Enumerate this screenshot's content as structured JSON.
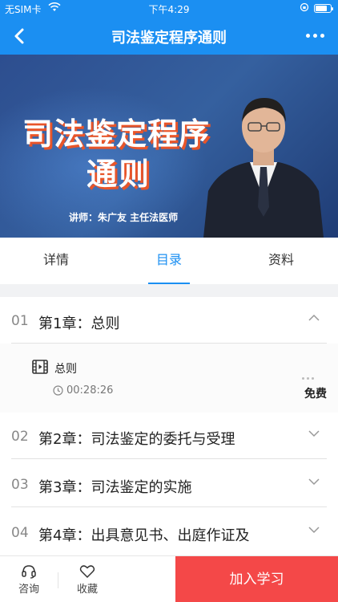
{
  "status_bar": {
    "carrier": "无SIM卡",
    "time": "下午4:29"
  },
  "nav": {
    "title": "司法鉴定程序通则",
    "back_icon": "chevron-left-icon",
    "more_icon": "more-dots-icon"
  },
  "banner": {
    "title_line1": "司法鉴定程序",
    "title_line2": "通则",
    "lecturer": "讲师：朱广友 主任法医师"
  },
  "tabs": [
    {
      "label": "详情",
      "active": false
    },
    {
      "label": "目录",
      "active": true
    },
    {
      "label": "资料",
      "active": false
    }
  ],
  "chapters": [
    {
      "num": "01",
      "title": "第1章：总则",
      "expanded": true
    },
    {
      "num": "02",
      "title": "第2章：司法鉴定的委托与受理",
      "expanded": false
    },
    {
      "num": "03",
      "title": "第3章：司法鉴定的实施",
      "expanded": false
    },
    {
      "num": "04",
      "title": "第4章：出具意见书、出庭作证及",
      "expanded": false
    }
  ],
  "lesson": {
    "title": "总则",
    "duration": "00:28:26",
    "price": "免费"
  },
  "bottom_bar": {
    "consult": "咨询",
    "favorite": "收藏",
    "join": "加入学习"
  },
  "colors": {
    "primary": "#1b8ff2",
    "join_button": "#f44848"
  }
}
